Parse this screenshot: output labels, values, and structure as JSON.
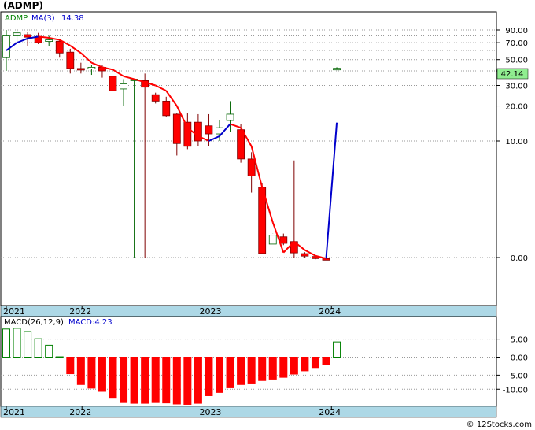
{
  "header": {
    "title": "(ADMP)"
  },
  "price_legend": {
    "symbol": "ADMP",
    "ma_label": "MA(3)",
    "ma_value": "14.38"
  },
  "macd_legend": {
    "label": "MACD(26,12,9)",
    "value_label": "MACD:4.23"
  },
  "last_price": "42.14",
  "footer": {
    "credit": "© 12Stocks.com"
  },
  "colors": {
    "up": "#008000",
    "down": "#ff0000",
    "ma_up": "#0000cc",
    "ma_down": "#ff0000",
    "axis_band": "#add8e6",
    "last_price_box": "#90ee90"
  },
  "chart_data": [
    {
      "type": "candlestick",
      "title": "(ADMP)",
      "x_ticks": [
        "2021",
        "2022",
        "2023",
        "2024"
      ],
      "y_ticks": [
        "90.00",
        "70.00",
        "50.00",
        "40.00",
        "30.00",
        "20.00",
        "10.00",
        "0.00"
      ],
      "scale": "log",
      "grid": true,
      "candles": [
        {
          "o": 52,
          "h": 90,
          "l": 40,
          "c": 80
        },
        {
          "o": 80,
          "h": 90,
          "l": 70,
          "c": 85
        },
        {
          "o": 82,
          "h": 86,
          "l": 65,
          "c": 78
        },
        {
          "o": 78,
          "h": 85,
          "l": 68,
          "c": 70
        },
        {
          "o": 72,
          "h": 80,
          "l": 65,
          "c": 74
        },
        {
          "o": 72,
          "h": 75,
          "l": 52,
          "c": 57
        },
        {
          "o": 58,
          "h": 62,
          "l": 38,
          "c": 42
        },
        {
          "o": 42,
          "h": 47,
          "l": 38,
          "c": 41
        },
        {
          "o": 42,
          "h": 45,
          "l": 37,
          "c": 43
        },
        {
          "o": 43,
          "h": 45,
          "l": 35,
          "c": 40
        },
        {
          "o": 36,
          "h": 38,
          "l": 26,
          "c": 27
        },
        {
          "o": 28,
          "h": 34,
          "l": 20,
          "c": 31
        },
        {
          "o": 33,
          "h": 34,
          "l": 0.25,
          "c": 34
        },
        {
          "o": 33,
          "h": 38,
          "l": 0.25,
          "c": 29
        },
        {
          "o": 25,
          "h": 26,
          "l": 21,
          "c": 22
        },
        {
          "o": 22,
          "h": 24,
          "l": 16,
          "c": 16.5
        },
        {
          "o": 17,
          "h": 17.5,
          "l": 7.5,
          "c": 9.5
        },
        {
          "o": 14.5,
          "h": 17.5,
          "l": 8.5,
          "c": 9
        },
        {
          "o": 14.5,
          "h": 17,
          "l": 9,
          "c": 10
        },
        {
          "o": 13.5,
          "h": 17,
          "l": 9,
          "c": 11.5
        },
        {
          "o": 11.5,
          "h": 15,
          "l": 10,
          "c": 13
        },
        {
          "o": 15,
          "h": 22,
          "l": 12,
          "c": 17
        },
        {
          "o": 12.5,
          "h": 14,
          "l": 6.5,
          "c": 7
        },
        {
          "o": 7,
          "h": 8,
          "l": 3.6,
          "c": 5
        },
        {
          "o": 4,
          "h": 4.3,
          "l": 0.98,
          "c": 1.08
        },
        {
          "o": 1.3,
          "h": 1.6,
          "l": 0.93,
          "c": 1.55
        },
        {
          "o": 1.5,
          "h": 1.6,
          "l": 0.6,
          "c": 0.65
        },
        {
          "o": 0.7,
          "h": 6.8,
          "l": 0.25,
          "c": 0.38
        },
        {
          "o": 0.36,
          "h": 0.4,
          "l": 0.25,
          "c": 0.29
        },
        {
          "o": 0.28,
          "h": 0.29,
          "l": 0.2,
          "c": 0.22
        },
        {
          "o": 0.22,
          "h": 0.23,
          "l": 0.19,
          "c": 0.2
        },
        {
          "o": 42.14,
          "h": 43,
          "l": 42,
          "c": 42.14
        }
      ],
      "ma": [
        60,
        70,
        76,
        79,
        77,
        74,
        66,
        57,
        47,
        43,
        41,
        36,
        34,
        32,
        30,
        27,
        20,
        13,
        11,
        10,
        11,
        14,
        13,
        9,
        4,
        2,
        1.1,
        0.7,
        0.46,
        0.3,
        0.22,
        14.38
      ],
      "series": [
        {
          "name": "MA(3)"
        }
      ]
    },
    {
      "type": "bar",
      "title": "MACD(26,12,9)",
      "x_ticks": [
        "2021",
        "2022",
        "2023",
        "2024"
      ],
      "y_ticks": [
        "5.00",
        "0.00",
        "-5.00",
        "-10.00"
      ],
      "ylim": [
        -13,
        9
      ],
      "values": [
        7.8,
        8.0,
        7.1,
        5.1,
        3.3,
        0.1,
        -4.6,
        -7.6,
        -8.6,
        -9.5,
        -11.4,
        -12.6,
        -12.8,
        -12.8,
        -12.6,
        -12.7,
        -13.0,
        -13.1,
        -12.8,
        -10.7,
        -9.8,
        -8.5,
        -7.6,
        -7.2,
        -6.5,
        -6.1,
        -5.6,
        -4.7,
        -3.8,
        -2.9,
        -2.0,
        4.23
      ],
      "series": [
        {
          "name": "MACD"
        }
      ]
    }
  ]
}
